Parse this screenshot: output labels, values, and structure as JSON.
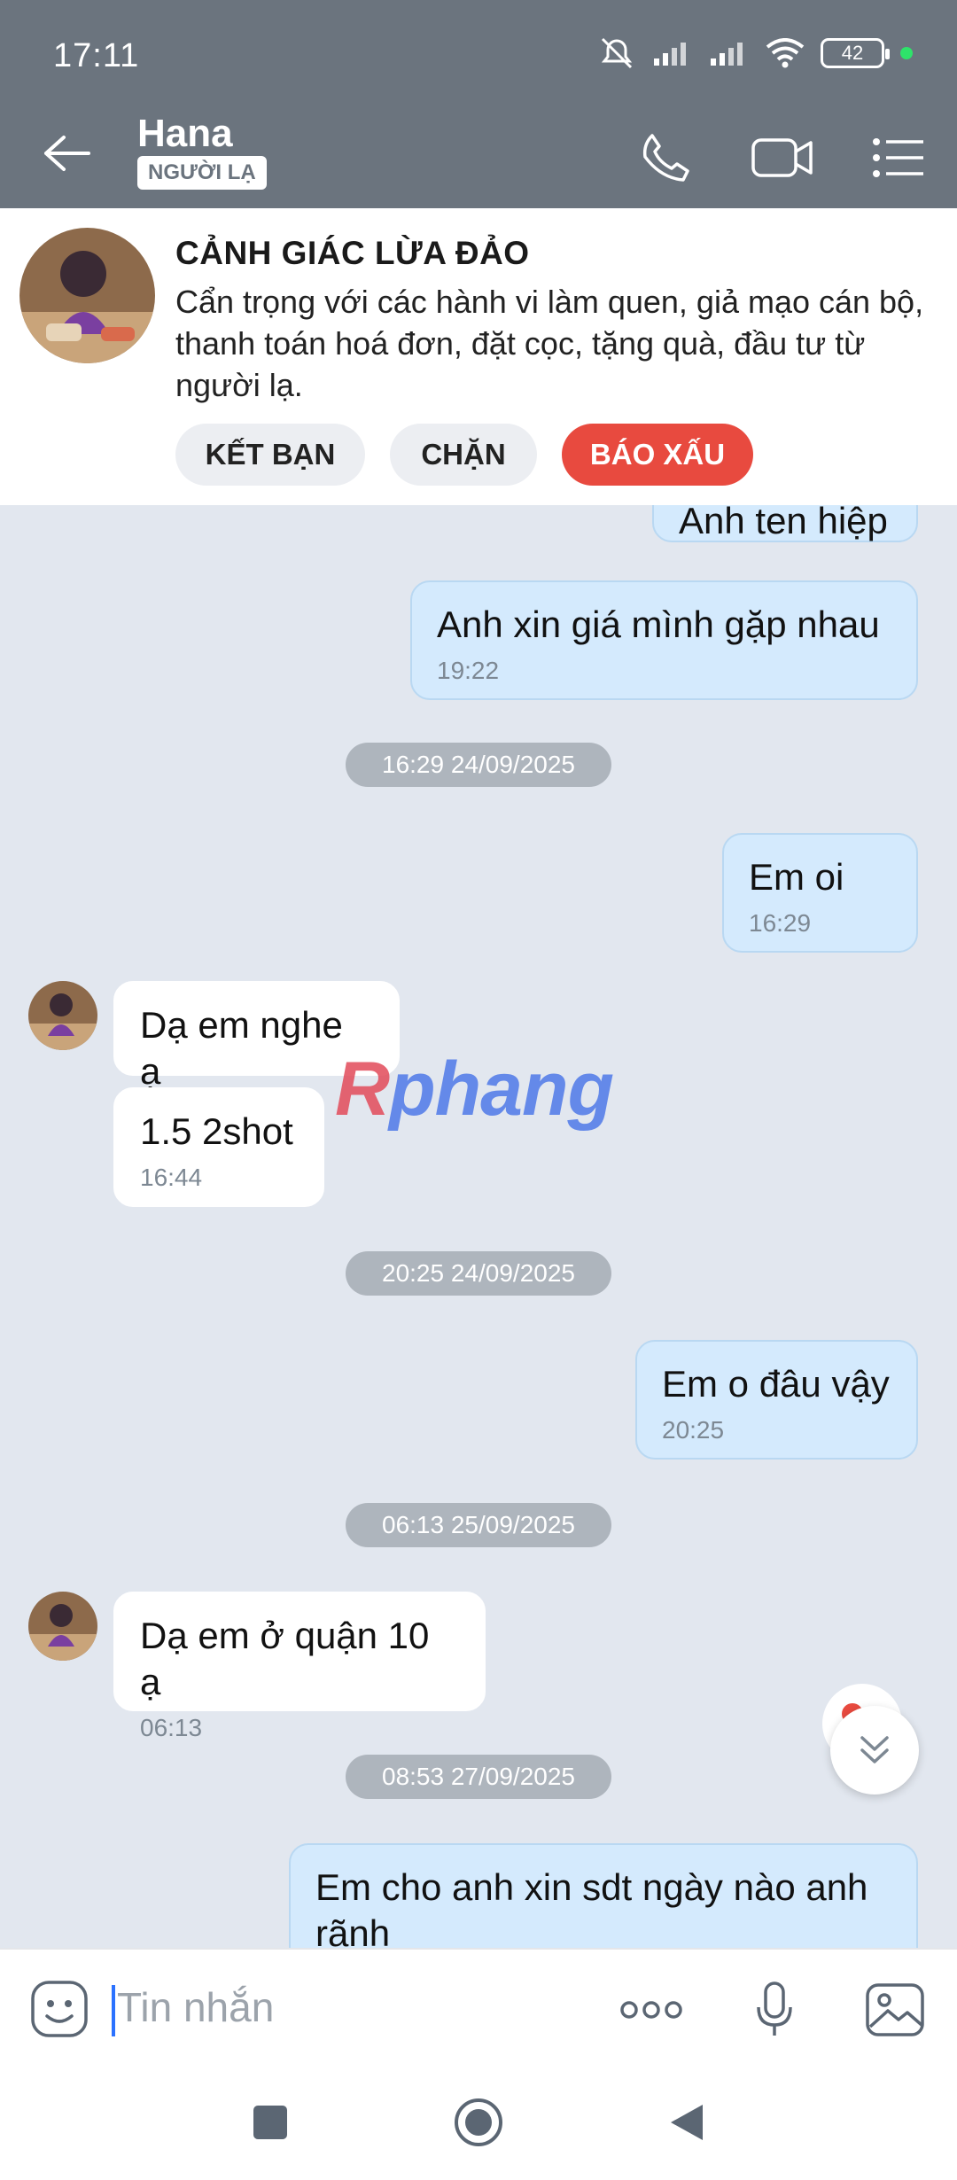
{
  "status_bar": {
    "time": "17:11",
    "battery": "42"
  },
  "header": {
    "name": "Hana",
    "badge": "NGƯỜI LẠ"
  },
  "warning": {
    "title": "CẢNH GIÁC LỪA ĐẢO",
    "text": "Cẩn trọng với các hành vi làm quen, giả mạo cán bộ, thanh toán hoá đơn, đặt cọc, tặng quà, đầu tư từ người lạ.",
    "buttons": {
      "add_friend": "KẾT BẠN",
      "block": "CHẶN",
      "report": "BÁO XẤU"
    }
  },
  "chat": {
    "messages": [
      {
        "text": "Anh ten hiệp"
      },
      {
        "text": "Anh xin giá mình gặp nhau",
        "time": "19:22"
      },
      {
        "date": "16:29 24/09/2025"
      },
      {
        "text": "Em oi",
        "time": "16:29"
      },
      {
        "text": "Dạ em nghe ạ"
      },
      {
        "text": "1.5 2shot",
        "time": "16:44"
      },
      {
        "date": "20:25 24/09/2025"
      },
      {
        "text": "Em o đâu vậy",
        "time": "20:25"
      },
      {
        "date": "06:13 25/09/2025"
      },
      {
        "text": "Dạ em ở quận 10 ạ",
        "time": "06:13"
      },
      {
        "date": "08:53 27/09/2025"
      },
      {
        "text": "Em cho anh xin sdt ngày nào anh rãnh"
      }
    ],
    "watermark": "Rphang"
  },
  "input": {
    "placeholder": "Tin nhắn"
  },
  "colors": {
    "header_bg": "#6b747e",
    "outgoing_bubble": "#d4eafd",
    "report_button": "#e84a3f",
    "chat_bg": "#e2e7ef"
  }
}
